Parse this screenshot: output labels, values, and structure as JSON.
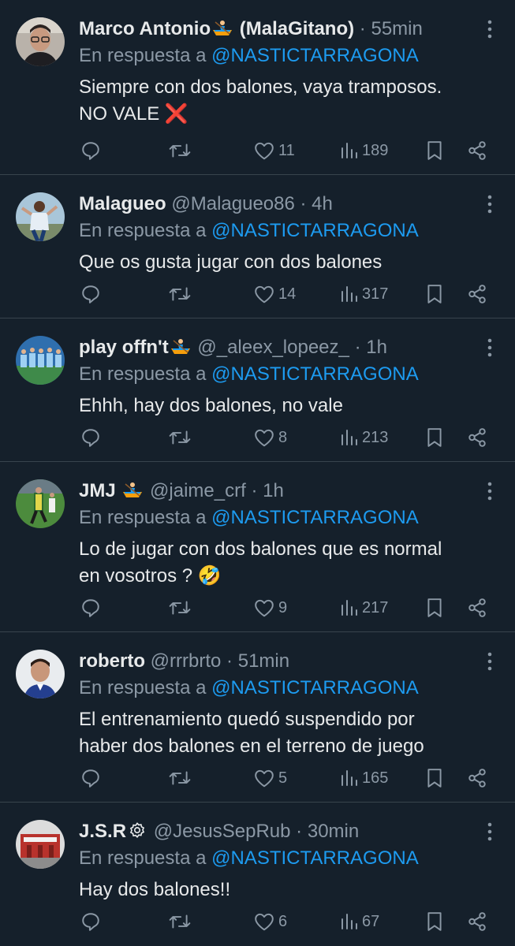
{
  "colors": {
    "background": "#15202b",
    "text": "#e7e9ea",
    "muted": "#8b98a5",
    "link": "#1d9bf0",
    "divider": "#38444d"
  },
  "replies": [
    {
      "name": "Marco Antonio",
      "name_suffix": "(MalaGitano)",
      "has_boat_emoji": true,
      "handle": "",
      "dot": "·",
      "time": "55min",
      "reply_prefix": "En respuesta a",
      "mention": "@NASTICTARRAGONA",
      "text_lines": [
        "Siempre con dos balones, vaya tramposos.",
        "NO VALE ❌"
      ],
      "likes": "11",
      "views": "189",
      "avatar_icon": "avatar-man-glasses"
    },
    {
      "name": "Malagueo",
      "name_suffix": "",
      "has_boat_emoji": false,
      "handle": "@Malagueo86",
      "dot": "·",
      "time": "4h",
      "reply_prefix": "En respuesta a",
      "mention": "@NASTICTARRAGONA",
      "text_lines": [
        "Que os gusta jugar con dos balones"
      ],
      "likes": "14",
      "views": "317",
      "avatar_icon": "avatar-player-sky"
    },
    {
      "name": "play offn't",
      "name_suffix": "",
      "has_boat_emoji": true,
      "handle": "@_aleex_lopeez_",
      "dot": "·",
      "time": "1h",
      "reply_prefix": "En respuesta a",
      "mention": "@NASTICTARRAGONA",
      "text_lines": [
        "Ehhh, hay dos balones, no vale"
      ],
      "likes": "8",
      "views": "213",
      "avatar_icon": "avatar-team-photo"
    },
    {
      "name": "JMJ",
      "name_suffix": "",
      "has_boat_emoji": true,
      "handle": "@jaime_crf",
      "dot": "·",
      "time": "1h",
      "reply_prefix": "En respuesta a",
      "mention": "@NASTICTARRAGONA",
      "text_lines": [
        "Lo de jugar con dos balones que es normal",
        "en vosotros ? 🤣"
      ],
      "likes": "9",
      "views": "217",
      "avatar_icon": "avatar-football-match"
    },
    {
      "name": "roberto",
      "name_suffix": "",
      "has_boat_emoji": false,
      "handle": "@rrrbrto",
      "dot": "·",
      "time": "51min",
      "reply_prefix": "En respuesta a",
      "mention": "@NASTICTARRAGONA",
      "text_lines": [
        "El entrenamiento quedó suspendido por",
        "haber dos balones en el terreno de juego"
      ],
      "likes": "5",
      "views": "165",
      "avatar_icon": "avatar-man-portrait"
    },
    {
      "name": "J.S.R",
      "name_suffix": "",
      "has_boat_emoji": false,
      "has_verified": true,
      "handle": "@JesusSepRub",
      "dot": "·",
      "time": "30min",
      "reply_prefix": "En respuesta a",
      "mention": "@NASTICTARRAGONA",
      "text_lines": [
        "Hay dos balones!!"
      ],
      "likes": "6",
      "views": "67",
      "avatar_icon": "avatar-stadium"
    }
  ]
}
